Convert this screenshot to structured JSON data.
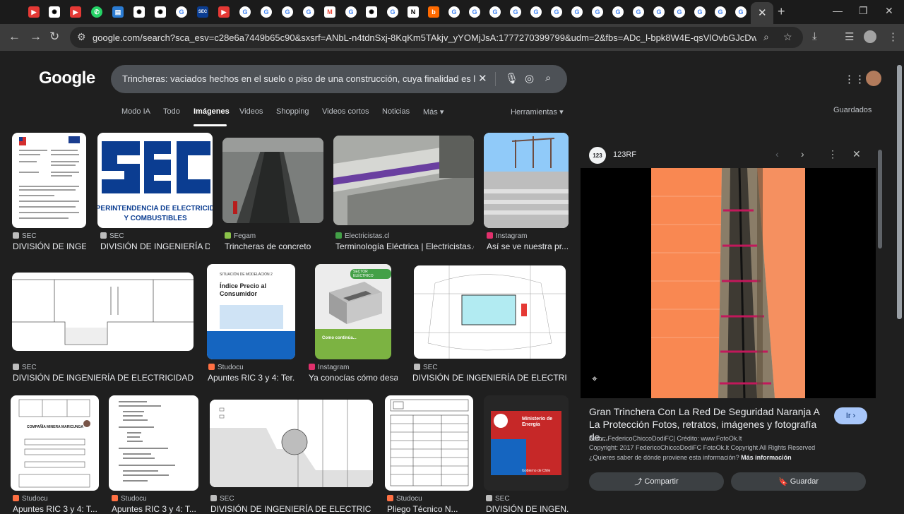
{
  "browser": {
    "url": "google.com/search?sca_esv=c28e6a7449b65c90&sxsrf=ANbL-n4tdnSxj-8KqKm5TAkjv_yYOMjJsA:1777270399799&udm=2&fbs=ADc_l-bpk8W4E-qsVlOvbGJcDwpn60DczFdcvPnuv8...",
    "tab_close": "✕",
    "new_tab": "+",
    "window_controls": [
      "—",
      "❐",
      "✕"
    ]
  },
  "google": {
    "logo": "Google",
    "query": "Trincheras: vaciados hechos en el suelo o piso de una construcción, cuya finalidad es la de",
    "tabs": [
      "Modo IA",
      "Todo",
      "Imágenes",
      "Videos",
      "Shopping",
      "Videos cortos",
      "Noticias",
      "Más ▾"
    ],
    "tools": "Herramientas ▾",
    "saved": "Guardados"
  },
  "results": {
    "row1": [
      {
        "source": "SEC",
        "title": "DIVISIÓN DE INGE..."
      },
      {
        "source": "SEC",
        "title": "DIVISIÓN DE INGENIERÍA D..."
      },
      {
        "source": "Fegam",
        "title": "Trincheras de concreto"
      },
      {
        "source": "Electricistas.cl",
        "title": "Terminología Eléctrica | Electricistas.cl"
      },
      {
        "source": "Instagram",
        "title": "Así se ve nuestra pr..."
      }
    ],
    "row2": [
      {
        "source": "SEC",
        "title": "DIVISIÓN DE INGENIERÍA DE ELECTRICIDAD P..."
      },
      {
        "source": "Studocu",
        "title": "Apuntes RIC 3 y 4: Ter..."
      },
      {
        "source": "Instagram",
        "title": "Ya conocías cómo desa..."
      },
      {
        "source": "SEC",
        "title": "DIVISIÓN DE INGENIERÍA DE ELECTRICI..."
      }
    ],
    "row3": [
      {
        "source": "Studocu",
        "title": "Apuntes RIC 3 y 4: T..."
      },
      {
        "source": "Studocu",
        "title": "Apuntes RIC 3 y 4: T..."
      },
      {
        "source": "SEC",
        "title": "DIVISIÓN DE INGENIERÍA DE ELECTRICID..."
      },
      {
        "source": "Studocu",
        "title": "Pliego Técnico N..."
      },
      {
        "source": "SEC",
        "title": "DIVISIÓN DE INGEN..."
      }
    ],
    "thumb_text": {
      "sec_logo": "SEC",
      "sec_sub1": "SUPERINTENDENCIA DE ELECTRICIDAD",
      "sec_sub2": "Y COMBUSTIBLES",
      "studocu_head": "SITUACIÓN DE MODELACIÓN 2",
      "studocu_title": "Índice Precio al Consumidor",
      "insta_badge": "SECTOR ELÉCTRICO",
      "insta_caption": "Como continúa...",
      "minist1": "Ministerio de",
      "minist2": "Energía",
      "minist3": "Gobierno de Chile",
      "doc_heading": "COMPAÑÍA MINERA MARICUNGA"
    }
  },
  "preview": {
    "site": "123RF",
    "logo_text": "123",
    "title": "Gran Trinchera Con La Red De Seguridad Naranja A La Protección Fotos, retratos, imágenes y fotografía de...",
    "go_button": "Ir ›",
    "author": "Autor: FedericoChiccoDodiFC| Crédito: www.FotoOk.lt",
    "copyright": "Copyright: 2017 FedericoChiccoDodiFC FotoOk.lt Copyright All Rights Reserved",
    "origin_q": "¿Quieres saber de dónde proviene esta información?",
    "more_info": "Más información",
    "share": "Compartir",
    "save": "Guardar"
  },
  "colors": {
    "page_bg": "#1f1f1f",
    "chrome_bg": "#3c3c3c",
    "accent_button": "#a8c7fa",
    "sec_blue": "#0b3d91",
    "safety_orange": "#ff7a3d"
  }
}
